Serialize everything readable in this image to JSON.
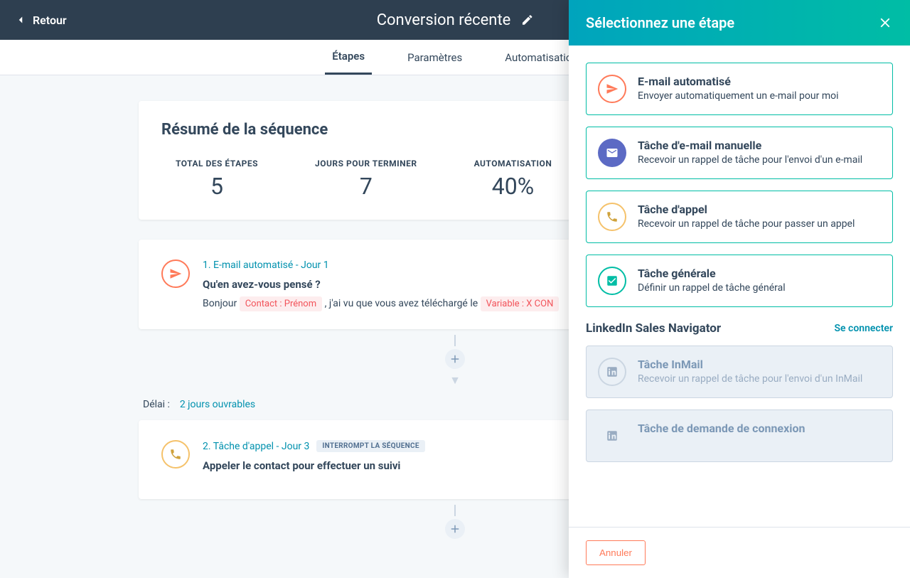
{
  "header": {
    "back": "Retour",
    "title": "Conversion récente"
  },
  "tabs": {
    "t1": "Étapes",
    "t2": "Paramètres",
    "t3": "Automatisation"
  },
  "summary": {
    "heading": "Résumé de la séquence",
    "labels": {
      "total": "TOTAL DES ÉTAPES",
      "days": "JOURS POUR TERMINER",
      "auto": "AUTOMATISATION"
    },
    "values": {
      "total": "5",
      "days": "7",
      "auto": "40%"
    }
  },
  "step1": {
    "heading": "1. E-mail automatisé - Jour 1",
    "subject": "Qu'en avez-vous pensé ?",
    "pre": "Bonjour ",
    "token1": "Contact : Prénom",
    "mid": " , j'ai vu que vous avez téléchargé le ",
    "token2": "Variable : X CON"
  },
  "delay": {
    "label": "Délai :",
    "value": "2 jours ouvrables"
  },
  "step2": {
    "heading": "2. Tâche d'appel - Jour 3",
    "pill": "INTERROMPT LA SÉQUENCE",
    "subject": "Appeler le contact pour effectuer un suivi"
  },
  "panel": {
    "title": "Sélectionnez une étape",
    "opts": {
      "o1": {
        "t": "E-mail automatisé",
        "d": "Envoyer automatiquement un e-mail pour moi"
      },
      "o2": {
        "t": "Tâche d'e-mail manuelle",
        "d": "Recevoir un rappel de tâche pour l'envoi d'un e-mail"
      },
      "o3": {
        "t": "Tâche d'appel",
        "d": "Recevoir un rappel de tâche pour passer un appel"
      },
      "o4": {
        "t": "Tâche générale",
        "d": "Définir un rappel de tâche général"
      }
    },
    "linkedin": {
      "title": "LinkedIn Sales Navigator",
      "connect": "Se connecter",
      "o5": {
        "t": "Tâche InMail",
        "d": "Recevoir un rappel de tâche pour l'envoi d'un InMail"
      },
      "o6": {
        "t": "Tâche de demande de connexion"
      }
    },
    "cancel": "Annuler"
  }
}
